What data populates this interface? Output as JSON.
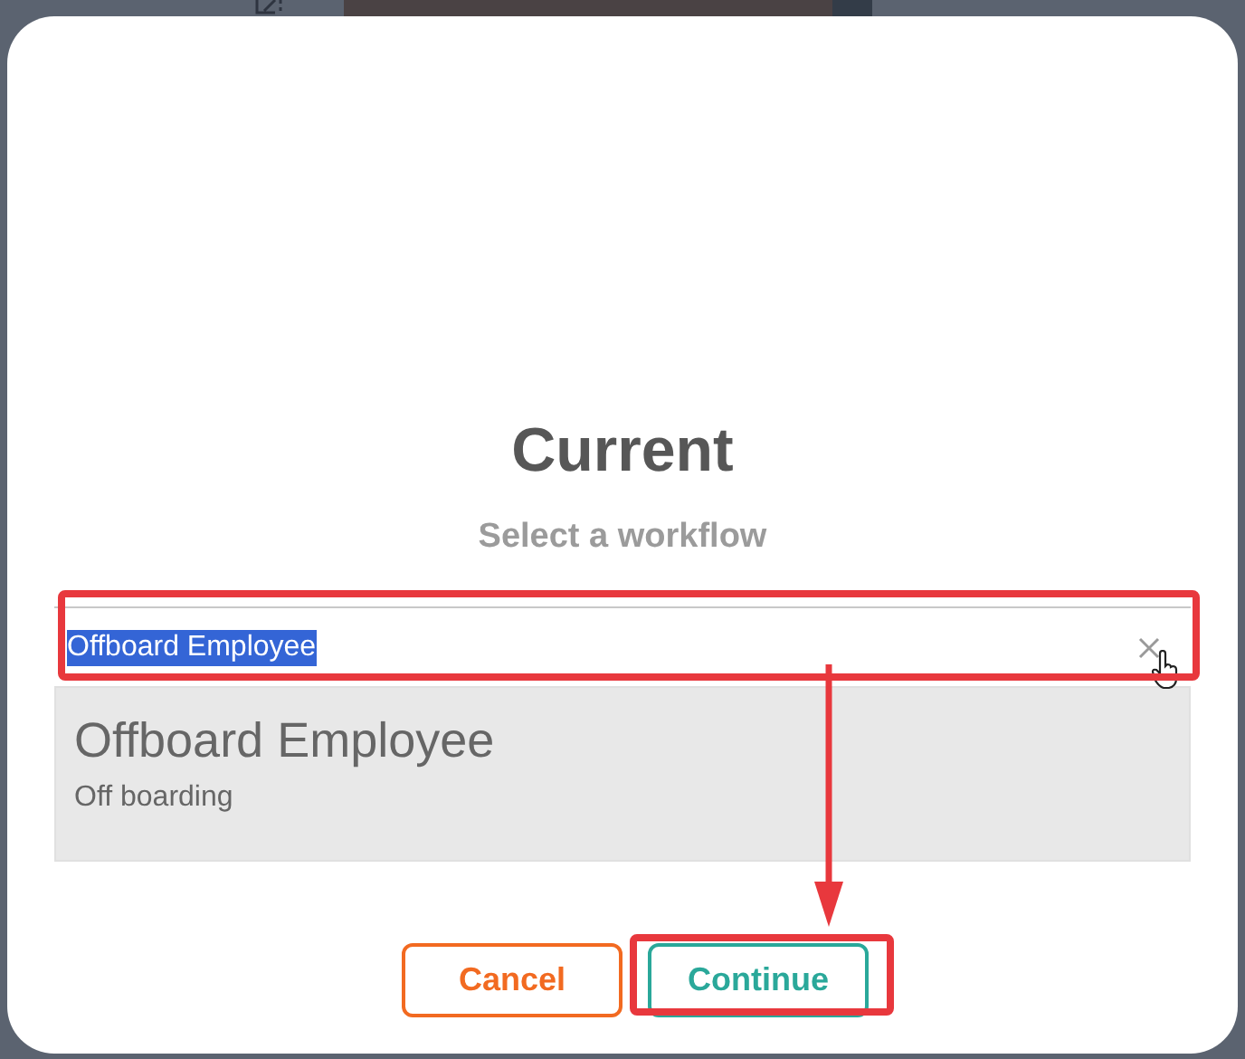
{
  "dialog": {
    "title": "Current",
    "subtitle": "Select a workflow",
    "select": {
      "value": "Offboard Employee",
      "value_highlighted": true
    },
    "options": [
      {
        "title": "Offboard Employee",
        "description": "Off boarding",
        "selected": true
      }
    ],
    "buttons": [
      {
        "label": "Cancel",
        "kind": "secondary"
      },
      {
        "label": "Continue",
        "kind": "primary"
      }
    ]
  },
  "annotations": [
    {
      "kind": "field-box"
    },
    {
      "kind": "arrow"
    },
    {
      "kind": "button-box"
    }
  ]
}
